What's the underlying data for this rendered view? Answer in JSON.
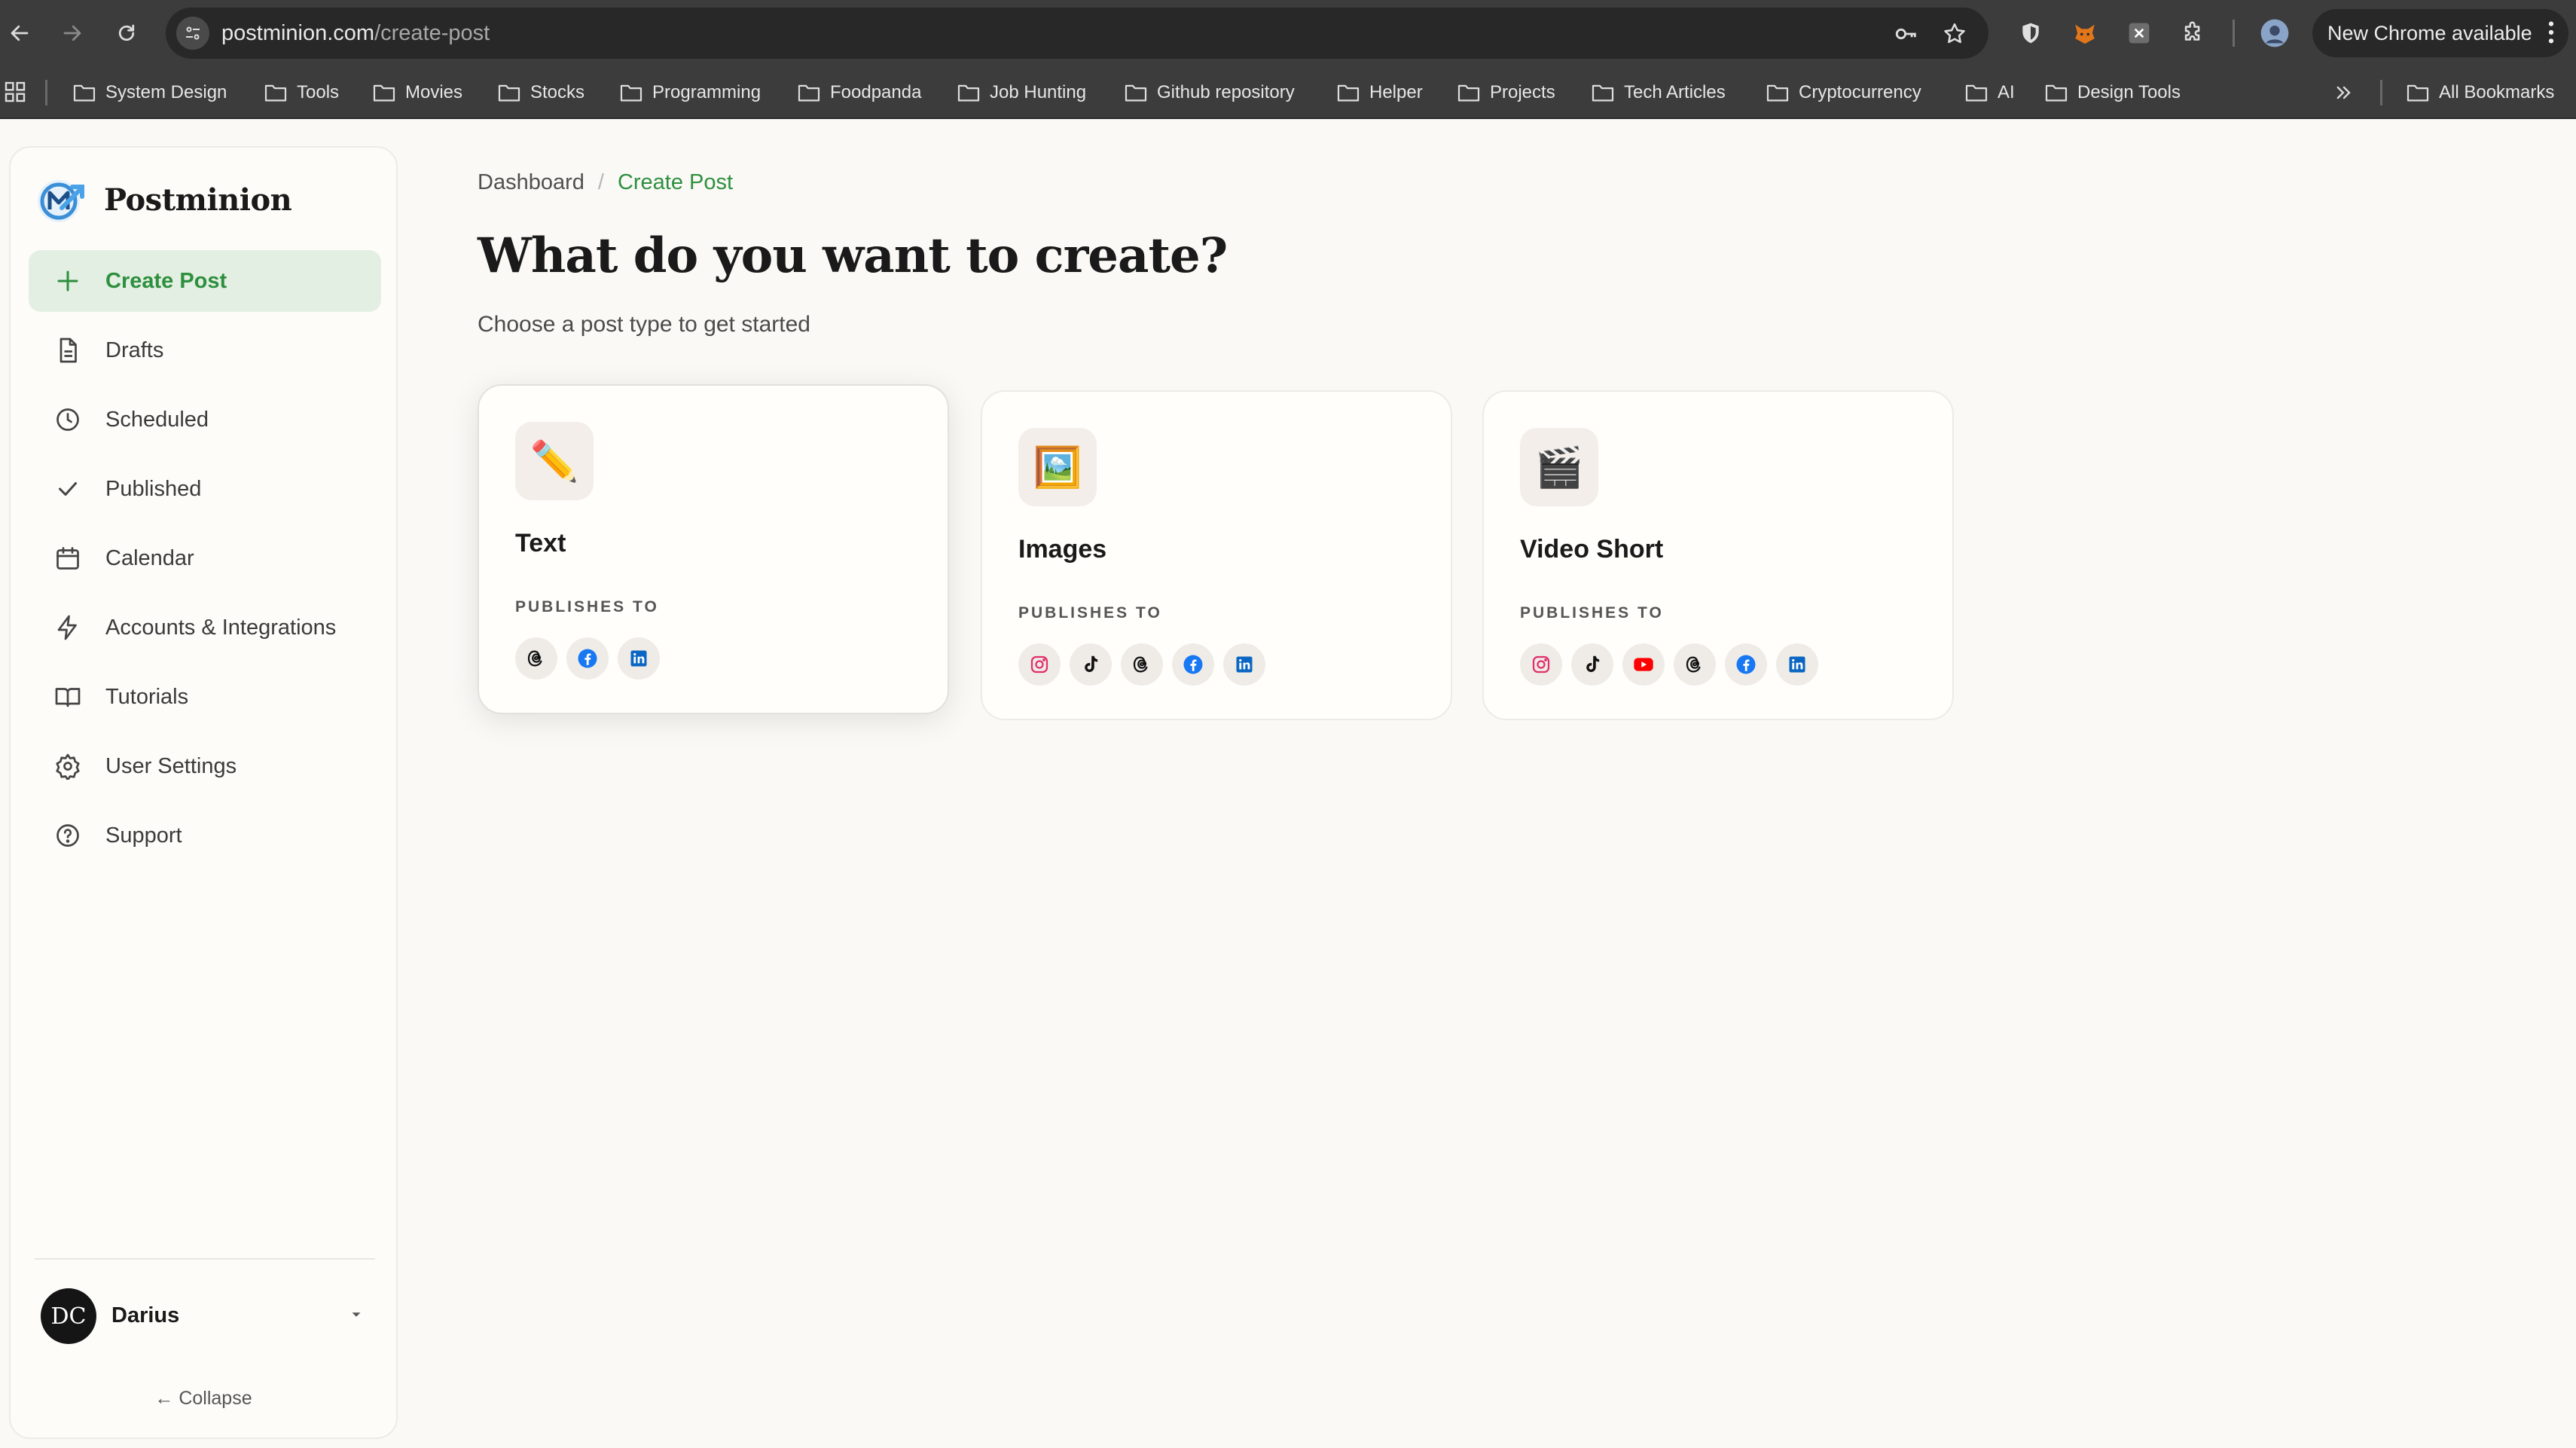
{
  "browser": {
    "url_host": "postminion.com",
    "url_path": "/create-post",
    "update_label": "New Chrome available"
  },
  "bookmarks": [
    {
      "label": "System Design"
    },
    {
      "label": "Tools"
    },
    {
      "label": "Movies"
    },
    {
      "label": "Stocks"
    },
    {
      "label": "Programming"
    },
    {
      "label": "Foodpanda"
    },
    {
      "label": "Job Hunting"
    },
    {
      "label": "Github repository"
    },
    {
      "label": "Helper"
    },
    {
      "label": "Projects"
    },
    {
      "label": "Tech Articles"
    },
    {
      "label": "Cryptocurrency"
    },
    {
      "label": "AI"
    },
    {
      "label": "Design Tools"
    }
  ],
  "all_bookmarks_label": "All Bookmarks",
  "sidebar": {
    "brand": "Postminion",
    "nav": [
      {
        "label": "Create Post",
        "icon": "plus-icon"
      },
      {
        "label": "Drafts",
        "icon": "file-icon"
      },
      {
        "label": "Scheduled",
        "icon": "clock-icon"
      },
      {
        "label": "Published",
        "icon": "check-icon"
      },
      {
        "label": "Calendar",
        "icon": "calendar-icon"
      },
      {
        "label": "Accounts & Integrations",
        "icon": "bolt-icon"
      },
      {
        "label": "Tutorials",
        "icon": "book-icon"
      },
      {
        "label": "User Settings",
        "icon": "gear-icon"
      },
      {
        "label": "Support",
        "icon": "help-circle-icon"
      }
    ],
    "user": {
      "initials": "DC",
      "name": "Darius"
    },
    "collapse_label": "← Collapse"
  },
  "main": {
    "breadcrumb": [
      "Dashboard",
      "Create Post"
    ],
    "breadcrumb_separator": "/",
    "title": "What do you want to create?",
    "subtitle": "Choose a post type to get started",
    "cards": [
      {
        "title": "Text",
        "emoji": "✏️",
        "publishes_label": "PUBLISHES TO",
        "platforms": [
          "threads",
          "facebook",
          "linkedin"
        ]
      },
      {
        "title": "Images",
        "emoji": "🖼️",
        "publishes_label": "PUBLISHES TO",
        "platforms": [
          "instagram",
          "tiktok",
          "threads",
          "facebook",
          "linkedin"
        ]
      },
      {
        "title": "Video Short",
        "emoji": "🎬",
        "publishes_label": "PUBLISHES TO",
        "platforms": [
          "instagram",
          "tiktok",
          "youtube",
          "threads",
          "facebook",
          "linkedin"
        ]
      }
    ]
  },
  "colors": {
    "accent_green": "#2e8f3e",
    "active_bg": "#e3efe2",
    "page_bg": "#faf9f6"
  }
}
